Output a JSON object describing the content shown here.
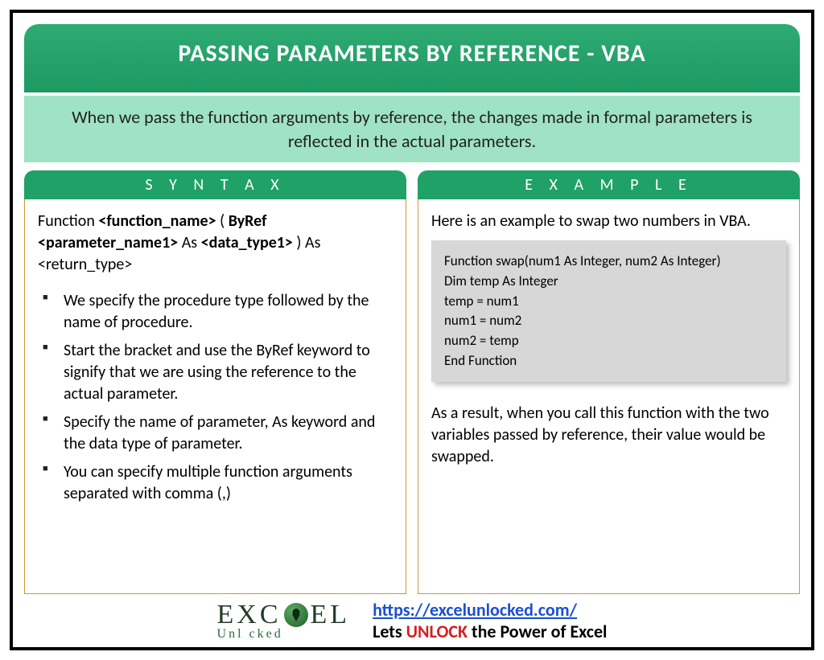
{
  "title": "PASSING PARAMETERS BY REFERENCE - VBA",
  "intro": "When we pass the function arguments by reference, the changes made in formal parameters is reflected in the actual parameters.",
  "syntax": {
    "heading": "S Y N T A X",
    "line_pre": "Function ",
    "fn": "<function_name>",
    "paren_open": " ( ",
    "byref": "ByRef ",
    "param": "<parameter_name1>",
    "as1": " As ",
    "dtype": "<data_type1>",
    "paren_close": " ) As ",
    "ret": "<return_type>",
    "bullets": [
      "We specify the procedure type followed by the name of procedure.",
      "Start the bracket and use the ByRef keyword to signify that we are using the reference to the actual parameter.",
      "Specify the name of parameter, As keyword and the data type of parameter.",
      "You can specify multiple function arguments separated with comma (,)"
    ]
  },
  "example": {
    "heading": "E X A M P L E",
    "intro": "Here is an example to swap two numbers in VBA.",
    "code": [
      "Function swap(num1 As Integer, num2 As Integer)",
      "Dim temp As Integer",
      "temp = num1",
      "num1 = num2",
      "num2 = temp",
      "End Function"
    ],
    "outro": "As a result, when you call this function with the two variables passed by reference, their value would be swapped."
  },
  "footer": {
    "logo_top_left": "EXC",
    "logo_top_right": "EL",
    "logo_sub": "Unl   cked",
    "url": "https://excelunlocked.com/",
    "tag_pre": "Lets ",
    "tag_unlock": "UNLOCK",
    "tag_post": " the Power of Excel"
  }
}
